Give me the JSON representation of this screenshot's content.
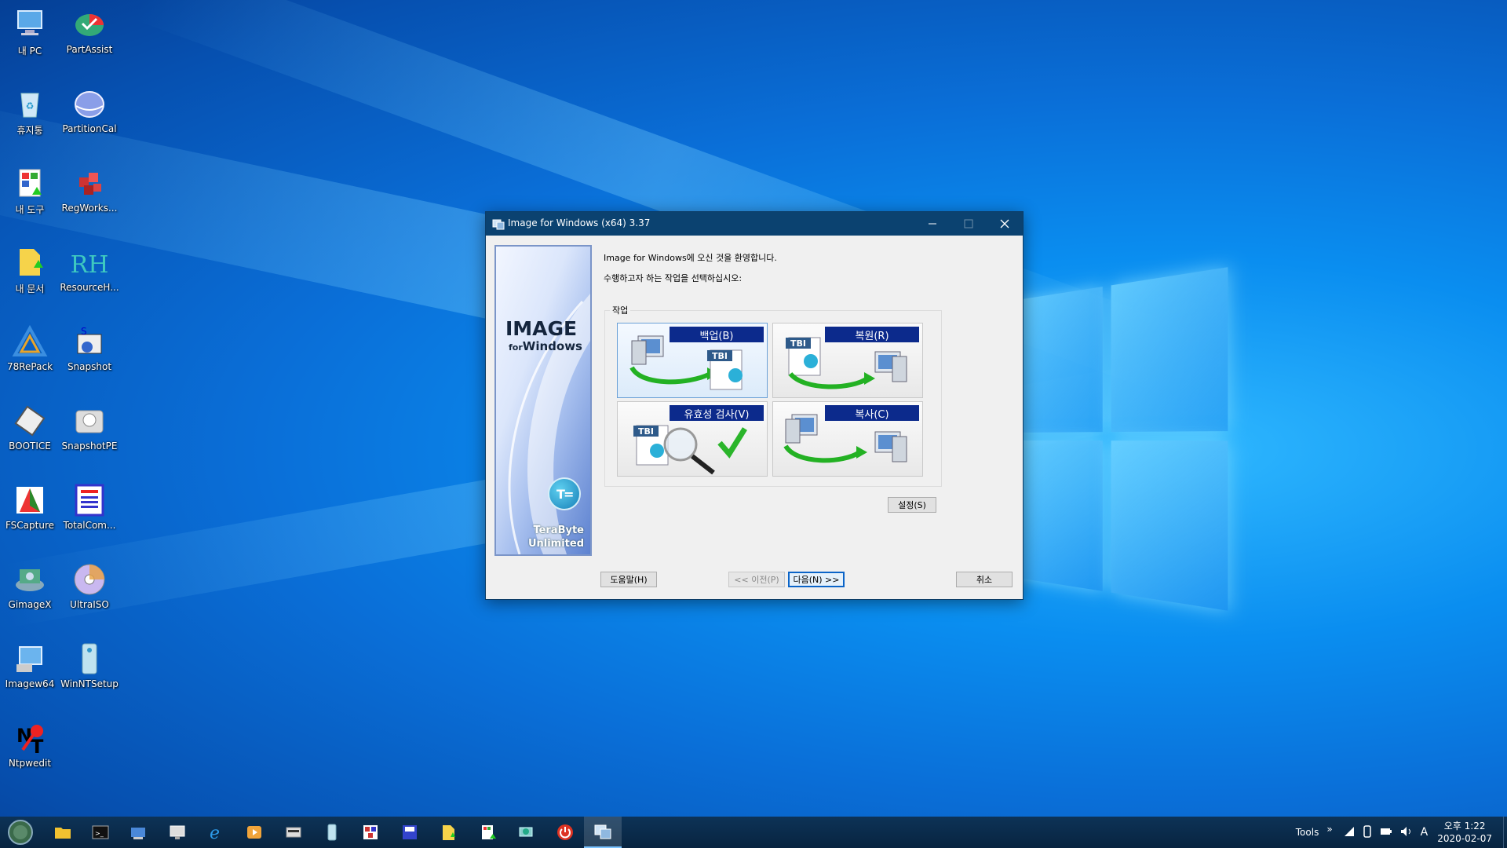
{
  "desktop": {
    "icons": [
      {
        "label": "내 PC",
        "icon": "pc-icon"
      },
      {
        "label": "PartAssist",
        "icon": "partassist-icon"
      },
      {
        "label": "휴지통",
        "icon": "recycle-bin-icon"
      },
      {
        "label": "PartitionCal",
        "icon": "partitioncal-icon"
      },
      {
        "label": "내 도구",
        "icon": "tools-folder-icon"
      },
      {
        "label": "RegWorks...",
        "icon": "regworkshop-icon"
      },
      {
        "label": "내 문서",
        "icon": "documents-folder-icon"
      },
      {
        "label": "ResourceH...",
        "icon": "resourcehacker-icon"
      },
      {
        "label": "78RePack",
        "icon": "repack-icon"
      },
      {
        "label": "Snapshot",
        "icon": "snapshot-icon"
      },
      {
        "label": "BOOTICE",
        "icon": "bootice-icon"
      },
      {
        "label": "SnapshotPE",
        "icon": "snapshotpe-icon"
      },
      {
        "label": "FSCapture",
        "icon": "fscapture-icon"
      },
      {
        "label": "TotalCom...",
        "icon": "totalcommander-icon"
      },
      {
        "label": "GimageX",
        "icon": "gimagex-icon"
      },
      {
        "label": "UltraISO",
        "icon": "ultraiso-icon"
      },
      {
        "label": "Imagew64",
        "icon": "imagew64-icon"
      },
      {
        "label": "WinNTSetup",
        "icon": "winntsetup-icon"
      },
      {
        "label": "Ntpwedit",
        "icon": "ntpwedit-icon"
      }
    ]
  },
  "window": {
    "title": "Image for Windows (x64) 3.37",
    "side": {
      "logo_line1": "IMAGE",
      "logo_line2_prefix": "for",
      "logo_line2_suffix": "Windows",
      "company_line1": "TeraByte",
      "company_line2": "Unlimited"
    },
    "welcome_brand": "Image for Windows",
    "welcome_suffix": "에 오신 것을 환영합니다.",
    "instruction": "수행하고자 하는 작업을 선택하십시오:",
    "group_label": "작업",
    "tasks": {
      "backup": "백업(B)",
      "restore": "복원(R)",
      "validate": "유효성 검사(V)",
      "copy": "복사(C)",
      "tbi_badge": "TBI"
    },
    "settings_button": "설정(S)",
    "help_button": "도움말(H)",
    "prev_button": "<< 이전(P)",
    "next_button": "다음(N) >>",
    "cancel_button": "취소"
  },
  "taskbar": {
    "tools_label": "Tools",
    "chevron": "»",
    "ime_label": "A",
    "time": "오후 1:22",
    "date": "2020-02-07"
  },
  "colors": {
    "titlebar": "#0b4270",
    "task_label_bg": "#0c2a8c",
    "taskbar": "#082440"
  }
}
